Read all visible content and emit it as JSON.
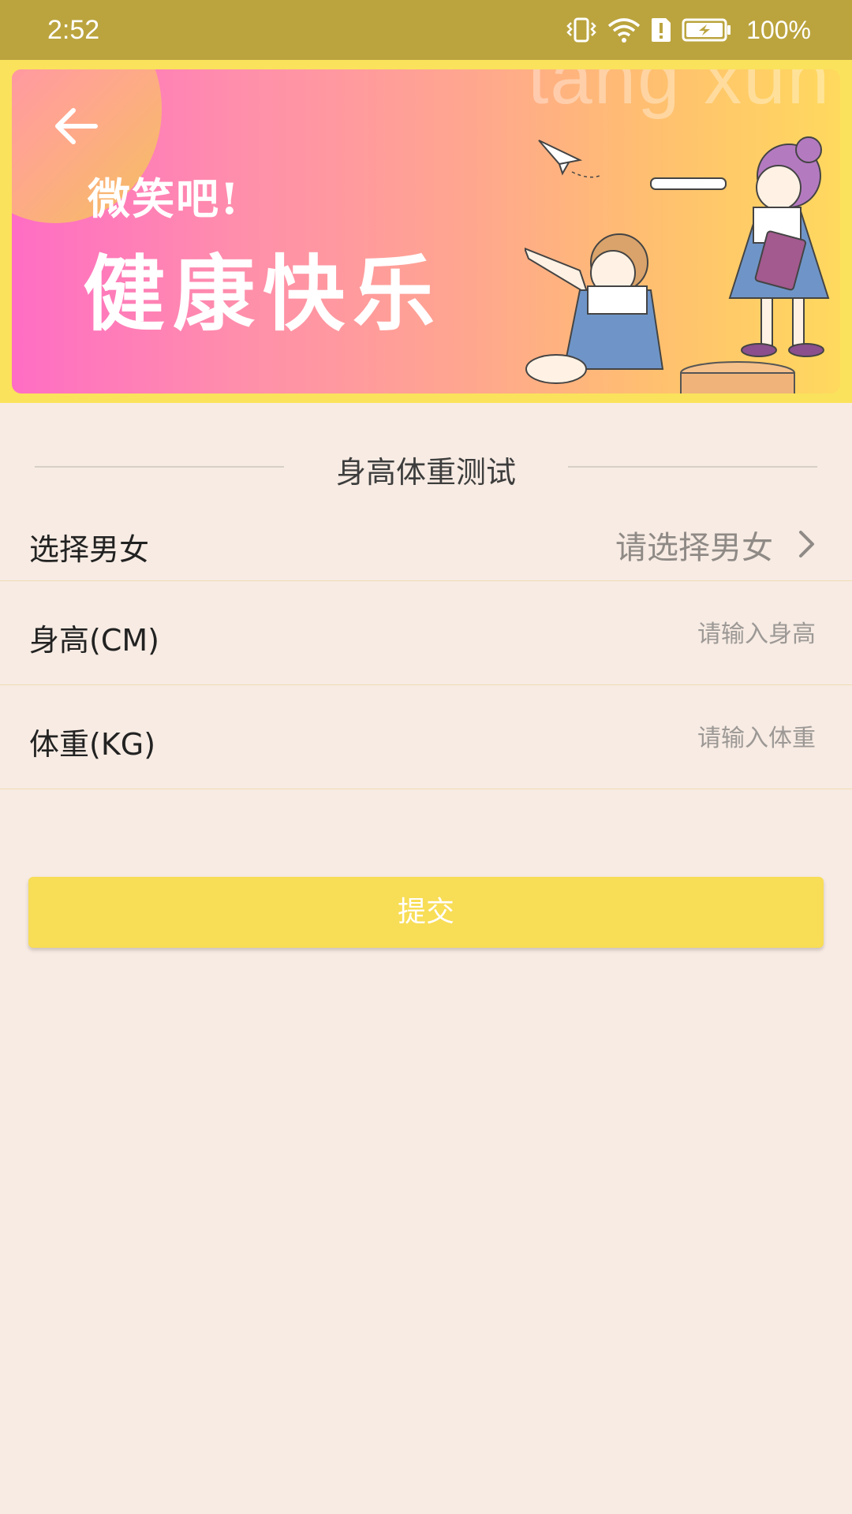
{
  "status_bar": {
    "time": "2:52",
    "battery": "100%",
    "icons": [
      "vibrate-icon",
      "wifi-icon",
      "alert-icon",
      "battery-charging-icon"
    ]
  },
  "banner": {
    "watermark": "tang xun",
    "small_text": "微笑吧!",
    "big_text": "健康快乐"
  },
  "section": {
    "title": "身高体重测试"
  },
  "form": {
    "gender": {
      "label": "选择男女",
      "placeholder": "请选择男女"
    },
    "height": {
      "label": "身高(CM)",
      "placeholder": "请输入身高"
    },
    "weight": {
      "label": "体重(KG)",
      "placeholder": "请输入体重"
    }
  },
  "submit": {
    "label": "提交"
  },
  "colors": {
    "status_bar": "#bba43e",
    "banner_frame": "#fae25c",
    "background": "#f7ebe3",
    "submit_button": "#f8dd56",
    "row_divider": "#f1dcb4"
  }
}
